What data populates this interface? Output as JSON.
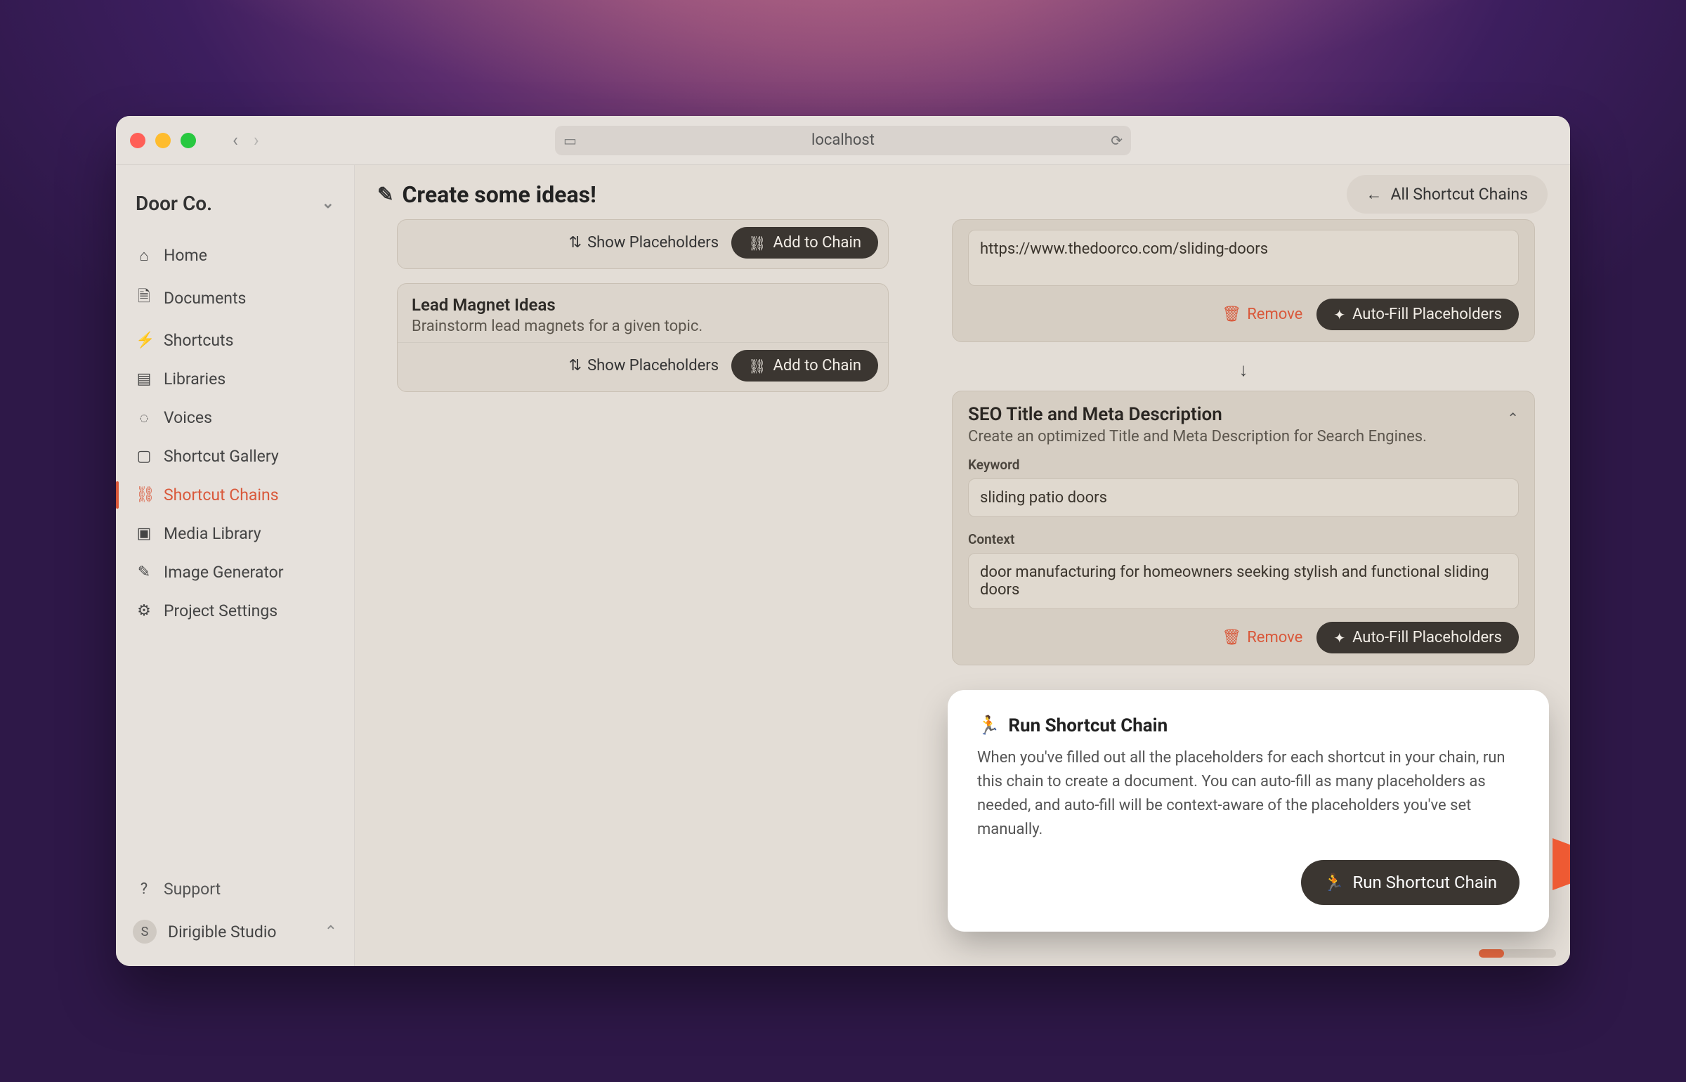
{
  "browser": {
    "address": "localhost"
  },
  "workspace": {
    "name": "Door Co.",
    "studio_initial": "S",
    "studio_name": "Dirigible Studio",
    "support_label": "Support"
  },
  "sidebar": {
    "items": [
      {
        "label": "Home"
      },
      {
        "label": "Documents"
      },
      {
        "label": "Shortcuts"
      },
      {
        "label": "Libraries"
      },
      {
        "label": "Voices"
      },
      {
        "label": "Shortcut Gallery"
      },
      {
        "label": "Shortcut Chains"
      },
      {
        "label": "Media Library"
      },
      {
        "label": "Image Generator"
      },
      {
        "label": "Project Settings"
      }
    ],
    "active_index": 6
  },
  "header": {
    "title": "Create some ideas!",
    "all_chains_label": "All Shortcut Chains"
  },
  "left_column": {
    "show_placeholders_label": "Show Placeholders",
    "add_to_chain_label": "Add to Chain",
    "cards": [
      {
        "title": "",
        "desc": "",
        "truncated": true
      },
      {
        "title": "Lead Magnet Ideas",
        "desc": "Brainstorm lead magnets for a given topic."
      }
    ]
  },
  "right_column": {
    "remove_label": "Remove",
    "autofill_label": "Auto-Fill Placeholders",
    "cards": [
      {
        "url_value": "https://www.thedoorco.com/sliding-doors"
      },
      {
        "title": "SEO Title and Meta Description",
        "desc": "Create an optimized Title and Meta Description for Search Engines.",
        "keyword_label": "Keyword",
        "keyword_value": "sliding patio doors",
        "context_label": "Context",
        "context_value": "door manufacturing for homeowners seeking stylish and functional sliding doors"
      }
    ]
  },
  "popover": {
    "title": "Run Shortcut Chain",
    "desc": "When you've filled out all the placeholders for each shortcut in your chain, run this chain to create a document. You can auto-fill as many placeholders as needed, and auto-fill will be context-aware of the placeholders you've set manually.",
    "button_label": "Run Shortcut Chain"
  },
  "colors": {
    "accent": "#d9583a",
    "dark_btn": "#3b3631"
  }
}
